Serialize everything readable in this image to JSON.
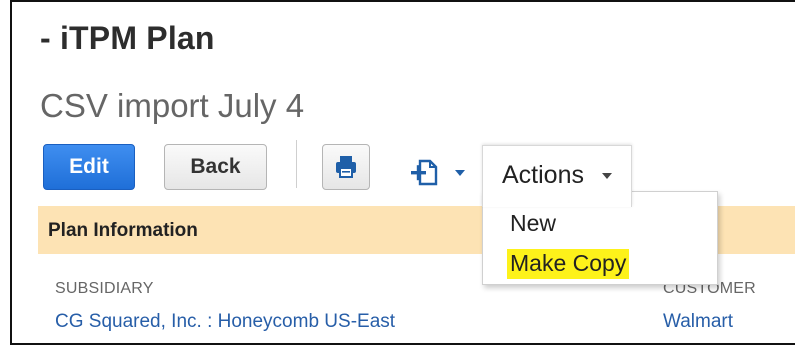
{
  "header": {
    "record_type": "- iTPM Plan",
    "record_name": "CSV import July 4"
  },
  "toolbar": {
    "edit_label": "Edit",
    "back_label": "Back",
    "print_icon": "print-icon",
    "new_record_icon": "new-record-icon",
    "actions_label": "Actions"
  },
  "actions_menu": {
    "items": [
      {
        "label": "New",
        "highlighted": false
      },
      {
        "label": "Make Copy",
        "highlighted": true,
        "highlight_color": "#fdf21a"
      }
    ]
  },
  "section": {
    "title": "Plan Information",
    "color": "#fde3b4"
  },
  "fields": {
    "subsidiary": {
      "label": "SUBSIDIARY",
      "value": "CG Squared, Inc. : Honeycomb US-East"
    },
    "customer": {
      "label": "CUSTOMER",
      "value": "Walmart"
    }
  },
  "colors": {
    "primary_button": "#2b7de9",
    "link": "#275ea8"
  }
}
